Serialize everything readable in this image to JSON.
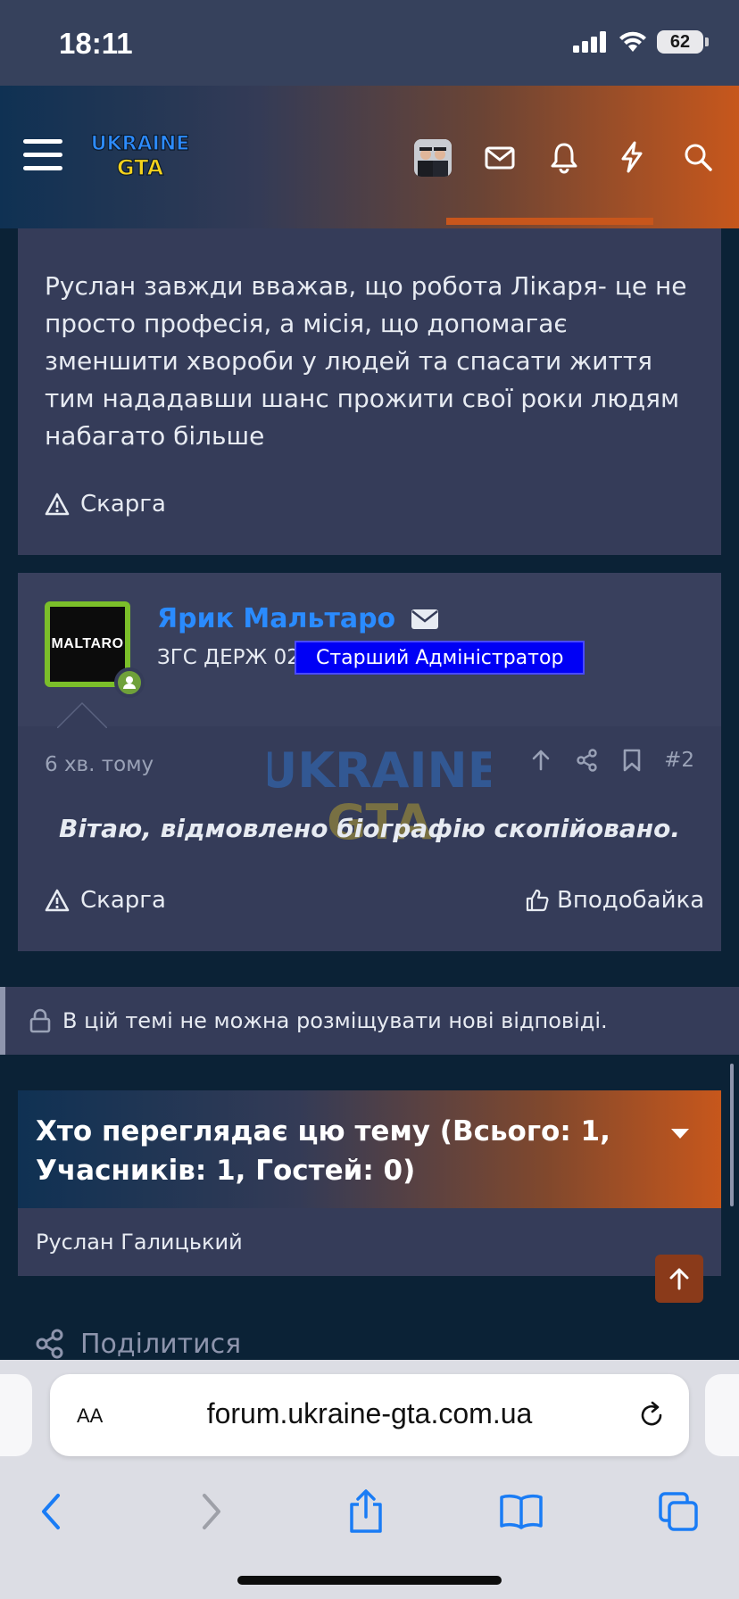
{
  "status_bar": {
    "time": "18:11",
    "battery": "62"
  },
  "header": {
    "logo_line1": "UKRAINE",
    "logo_line2": "GTA"
  },
  "post1": {
    "text": "Руслан завжди вважав, що робота Лікаря- це не просто професія, а місія, що допомагає зменшити хвороби у людей та спасати життя тим нададавши шанс прожити свої роки людям набагато більше",
    "report_label": "Скарга"
  },
  "post2": {
    "avatar_text": "MALTARO",
    "author": "Ярик Мальтаро",
    "user_title": "ЗГС ДЕРЖ 02",
    "role_badge": "Старший Адміністратор",
    "time": "6 хв. тому",
    "post_number": "#2",
    "text": "Вітаю, відмовлено біографію скопійовано.",
    "report_label": "Скарга",
    "like_label": "Вподобайка"
  },
  "locked_notice": "В цій темі не можна розміщувати нові відповіді.",
  "viewers": {
    "title": "Хто переглядає цю тему (Всього: 1, Учасників: 1, Гостей: 0)",
    "users": "Руслан Галицький"
  },
  "share_label": "Поділитися",
  "safari": {
    "text_size_label": "AA",
    "url": "forum.ukraine-gta.com.ua"
  },
  "colors": {
    "accent_orange": "#c7571c",
    "author_blue": "#2a8bff",
    "badge_blue": "#0000f5",
    "online_green": "#7bbf2a"
  }
}
